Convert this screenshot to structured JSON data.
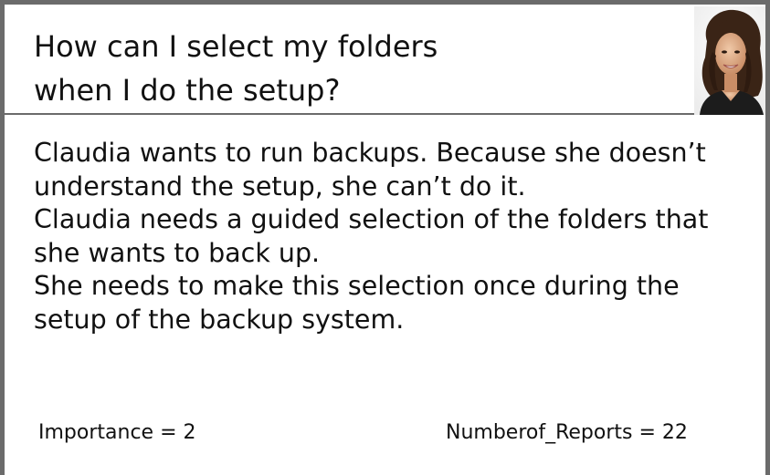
{
  "card": {
    "title": {
      "line1": "How can I select my folders",
      "line2": "when I do the setup?"
    },
    "description_lines": [
      "Claudia wants to run backups. Because she doesn’t",
      "understand the setup, she can’t do it.",
      "Claudia needs a guided selection of the folders that",
      "she wants to back up.",
      "She needs to make this selection once during the",
      "setup of the backup system."
    ],
    "importance_text": "Importance = 2",
    "reports_text": "Numberof_Reports = 22"
  },
  "colors": {
    "border": "#6b6b6b",
    "background": "#ffffff",
    "text": "#111111"
  },
  "icons": {
    "photo": "persona-portrait"
  }
}
